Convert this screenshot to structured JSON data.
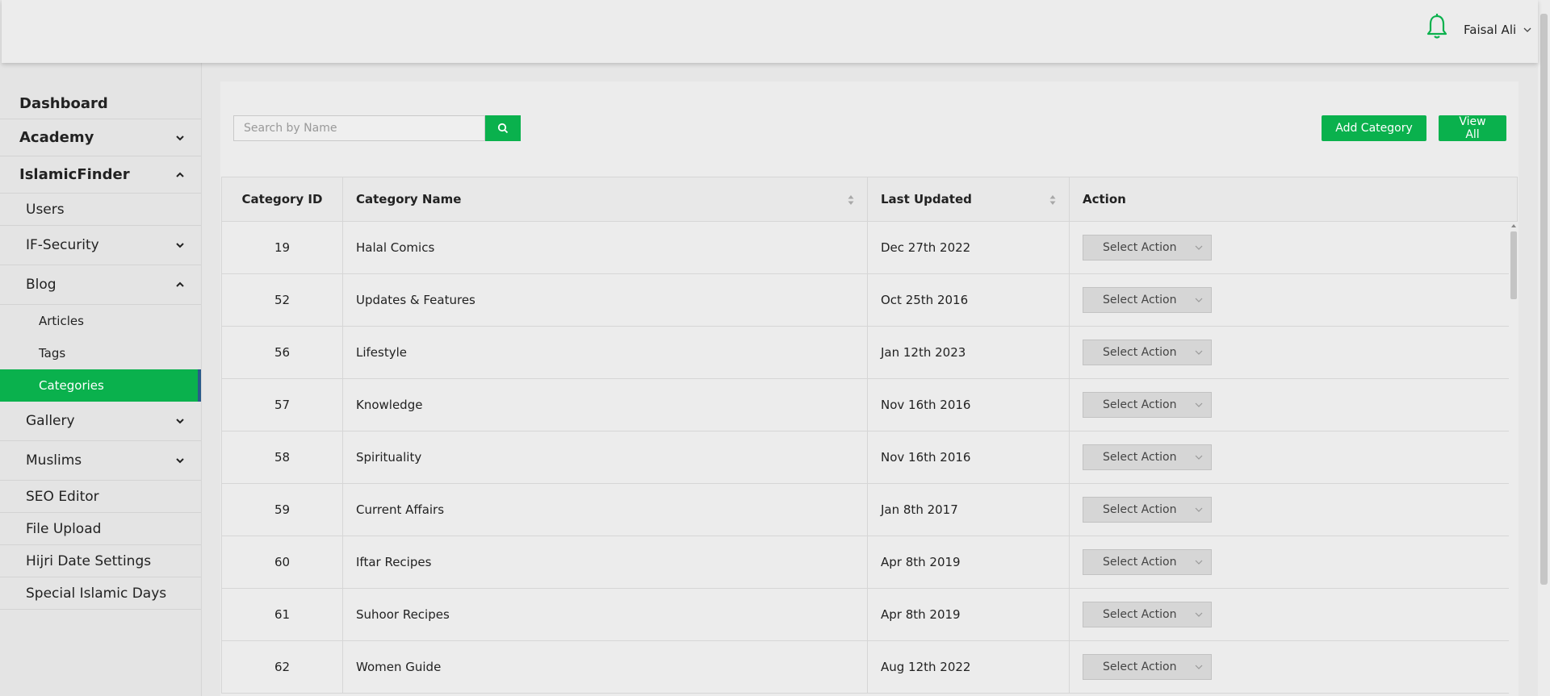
{
  "header": {
    "user_name": "Faisal Ali",
    "icons": {
      "bell": "bell-icon",
      "user_dropdown": "chevron-down-icon"
    }
  },
  "colors": {
    "accent": "#0ab14d",
    "active_border": "#2a5a8a"
  },
  "sidebar": {
    "items": [
      {
        "label": "Dashboard",
        "level": 0,
        "expandable": false
      },
      {
        "label": "Academy",
        "level": 0,
        "expandable": true,
        "expanded": false
      },
      {
        "label": "IslamicFinder",
        "level": 0,
        "expandable": true,
        "expanded": true
      },
      {
        "label": "Users",
        "level": 1,
        "expandable": false
      },
      {
        "label": "IF-Security",
        "level": 1,
        "expandable": true,
        "expanded": false
      },
      {
        "label": "Blog",
        "level": 1,
        "expandable": true,
        "expanded": true
      },
      {
        "label": "Articles",
        "level": 2
      },
      {
        "label": "Tags",
        "level": 2
      },
      {
        "label": "Categories",
        "level": 2,
        "active": true
      },
      {
        "label": "Gallery",
        "level": 1,
        "expandable": true,
        "expanded": false
      },
      {
        "label": "Muslims",
        "level": 1,
        "expandable": true,
        "expanded": false
      },
      {
        "label": "SEO Editor",
        "level": 1
      },
      {
        "label": "File Upload",
        "level": 1
      },
      {
        "label": "Hijri Date Settings",
        "level": 1
      },
      {
        "label": "Special Islamic Days",
        "level": 1
      }
    ]
  },
  "toolbar": {
    "search_placeholder": "Search by Name",
    "search_value": "",
    "add_label": "Add Category",
    "view_all_label": "View All"
  },
  "table": {
    "columns": [
      "Category ID",
      "Category Name",
      "Last Updated",
      "Action"
    ],
    "rows": [
      {
        "id": "19",
        "name": "Halal Comics",
        "updated": "Dec 27th 2022",
        "action": "Select Action"
      },
      {
        "id": "52",
        "name": "Updates & Features",
        "updated": "Oct 25th 2016",
        "action": "Select Action"
      },
      {
        "id": "56",
        "name": "Lifestyle",
        "updated": "Jan 12th 2023",
        "action": "Select Action"
      },
      {
        "id": "57",
        "name": "Knowledge",
        "updated": "Nov 16th 2016",
        "action": "Select Action"
      },
      {
        "id": "58",
        "name": "Spirituality",
        "updated": "Nov 16th 2016",
        "action": "Select Action"
      },
      {
        "id": "59",
        "name": "Current Affairs",
        "updated": "Jan 8th 2017",
        "action": "Select Action"
      },
      {
        "id": "60",
        "name": "Iftar Recipes",
        "updated": "Apr 8th 2019",
        "action": "Select Action"
      },
      {
        "id": "61",
        "name": "Suhoor Recipes",
        "updated": "Apr 8th 2019",
        "action": "Select Action"
      },
      {
        "id": "62",
        "name": "Women Guide",
        "updated": "Aug 12th 2022",
        "action": "Select Action"
      }
    ]
  }
}
